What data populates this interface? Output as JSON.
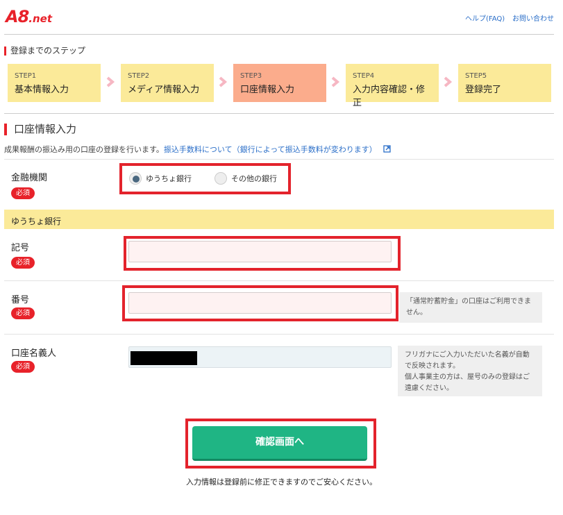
{
  "header": {
    "logo_main": "A8",
    "logo_sub": ".net",
    "help_link": "ヘルプ(FAQ)",
    "contact_link": "お問い合わせ"
  },
  "steps_heading": "登録までのステップ",
  "steps": [
    {
      "num": "STEP1",
      "label": "基本情報入力"
    },
    {
      "num": "STEP2",
      "label": "メディア情報入力"
    },
    {
      "num": "STEP3",
      "label": "口座情報入力"
    },
    {
      "num": "STEP4",
      "label": "入力内容確認・修正"
    },
    {
      "num": "STEP5",
      "label": "登録完了"
    }
  ],
  "section_title": "口座情報入力",
  "description": {
    "text": "成果報酬の振込み用の口座の登録を行います。",
    "link": "振込手数料について（銀行によって振込手数料が変わります）"
  },
  "required_label": "必須",
  "bank": {
    "label": "金融機関",
    "options": [
      "ゆうちょ銀行",
      "その他の銀行"
    ],
    "selected": "ゆうちょ銀行"
  },
  "yucho_bar": "ゆうちょ銀行",
  "fields": {
    "kigo": {
      "label": "記号",
      "value": ""
    },
    "bango": {
      "label": "番号",
      "value": "",
      "hint": "「通常貯蓄貯金」の口座はご利用できません。"
    },
    "meigi": {
      "label": "口座名義人",
      "hint1": "フリガナにご入力いただいた名義が自動で反映されます。",
      "hint2": "個人事業主の方は、屋号のみの登録はご遠慮ください。"
    }
  },
  "confirm_button": "確認画面へ",
  "footer_note": "入力情報は登録前に修正できますのでご安心ください。",
  "colors": {
    "accent": "#e8222a",
    "step": "#fbea99",
    "step_active": "#fbac8c",
    "button": "#1fb584",
    "link": "#2a6ec8"
  }
}
